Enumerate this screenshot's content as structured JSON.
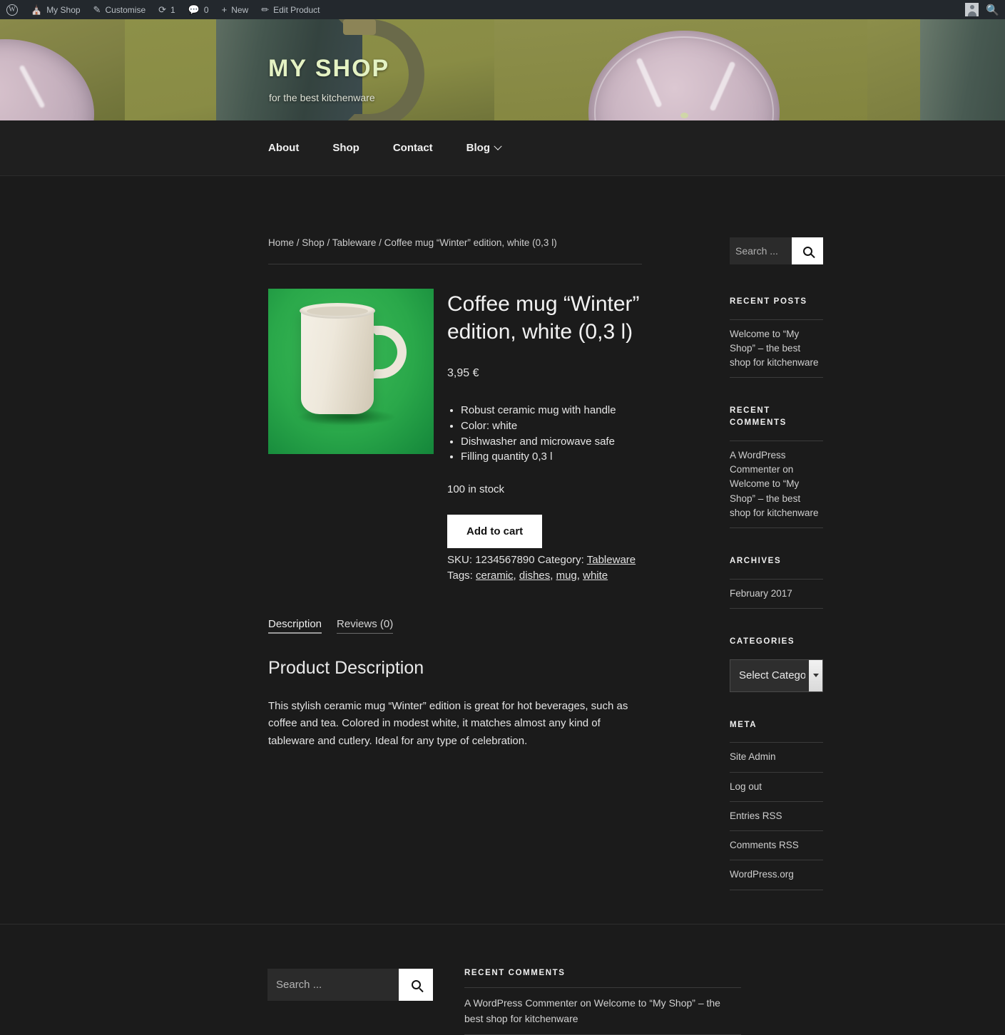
{
  "adminbar": {
    "logo_icon": "wordpress-logo-icon",
    "items": [
      {
        "icon": "site-icon",
        "label": "My Shop"
      },
      {
        "icon": "pencil-icon",
        "label": "Customise"
      },
      {
        "icon": "refresh-icon",
        "label": "1"
      },
      {
        "icon": "comment-icon",
        "label": "0"
      },
      {
        "icon": "plus-icon",
        "label": "New"
      },
      {
        "icon": "edit-icon",
        "label": "Edit Product"
      }
    ],
    "account_name_redacted": "",
    "avatar_icon": "user-avatar-icon",
    "search_icon": "search-icon"
  },
  "header": {
    "site_title": "MY SHOP",
    "tagline": "for the best kitchenware",
    "title_color": "#e4f2c3"
  },
  "nav": {
    "items": [
      {
        "label": "About",
        "has_dropdown": false
      },
      {
        "label": "Shop",
        "has_dropdown": false
      },
      {
        "label": "Contact",
        "has_dropdown": false
      },
      {
        "label": "Blog",
        "has_dropdown": true
      }
    ]
  },
  "breadcrumb": {
    "full": "Home / Shop / Tableware / Coffee mug “Winter” edition, white (0,3 l)",
    "parts": [
      "Home",
      "Shop",
      "Tableware",
      "Coffee mug “Winter” edition, white (0,3 l)"
    ]
  },
  "product": {
    "image_alt": "white ceramic coffee mug on green background",
    "title": "Coffee mug “Winter” edition, white (0,3 l)",
    "price": "3,95 €",
    "features": [
      "Robust ceramic mug with  handle",
      "Color: white",
      "Dishwasher and microwave safe",
      "Filling quantity 0,3 l"
    ],
    "stock": "100 in stock",
    "add_to_cart_label": "Add to cart",
    "meta": {
      "sku_label": "SKU:",
      "sku_value": "1234567890",
      "category_label": "Category:",
      "category_value": "Tableware",
      "tags_label": "Tags:",
      "tags": [
        "ceramic",
        "dishes",
        "mug",
        "white"
      ]
    }
  },
  "tabs": {
    "items": [
      {
        "label": "Description",
        "active": true
      },
      {
        "label": "Reviews (0)",
        "active": false
      }
    ]
  },
  "description": {
    "heading": "Product Description",
    "body": "This stylish ceramic mug “Winter” edition is great for hot beverages, such as coffee and tea. Colored in modest white, it matches almost any kind of tableware and cutlery. Ideal for any type of celebration."
  },
  "sidebar": {
    "search": {
      "placeholder": "Search ...",
      "value": "",
      "button_icon": "search-icon"
    },
    "recent_posts": {
      "title": "Recent Posts",
      "items": [
        "Welcome to “My Shop” – the best shop for kitchenware"
      ]
    },
    "recent_comments": {
      "title": "Recent Comments",
      "items": [
        "A WordPress Commenter on Welcome to “My Shop” – the best shop for kitchenware"
      ]
    },
    "archives": {
      "title": "Archives",
      "items": [
        "February 2017"
      ]
    },
    "categories": {
      "title": "Categories",
      "selected": "Select Category",
      "options": [
        "Select Category"
      ]
    },
    "meta": {
      "title": "Meta",
      "items": [
        "Site Admin",
        "Log out",
        "Entries RSS",
        "Comments RSS",
        "WordPress.org"
      ]
    }
  },
  "footer": {
    "search": {
      "placeholder": "Search ...",
      "value": "",
      "button_icon": "search-icon"
    },
    "recent_comments": {
      "title": "Recent Comments",
      "items": [
        "A WordPress Commenter on Welcome to “My Shop” – the best shop for kitchenware"
      ]
    }
  }
}
